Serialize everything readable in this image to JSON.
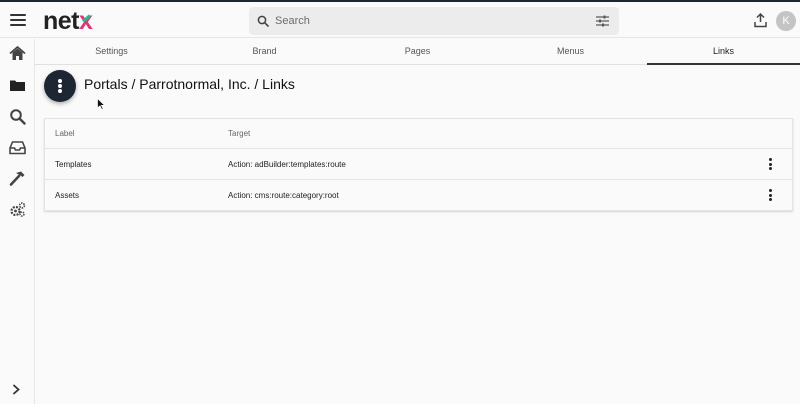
{
  "header": {
    "logo": {
      "prefix": "net",
      "x_letter": "x"
    },
    "search": {
      "placeholder": "Search",
      "value": ""
    },
    "avatar_initial": "K",
    "icons": [
      "menu-icon",
      "search-icon",
      "filter-settings-icon",
      "upload-icon"
    ]
  },
  "sidebar": {
    "items": [
      {
        "name": "home",
        "icon": "home-icon"
      },
      {
        "name": "folders",
        "icon": "folder-icon"
      },
      {
        "name": "search",
        "icon": "search-icon"
      },
      {
        "name": "inbox",
        "icon": "inbox-icon"
      },
      {
        "name": "tools",
        "icon": "hammer-icon"
      },
      {
        "name": "settings",
        "icon": "gears-icon"
      }
    ],
    "expand_icon": "chevron-right-icon"
  },
  "tabs": [
    {
      "label": "Settings",
      "active": false
    },
    {
      "label": "Brand",
      "active": false
    },
    {
      "label": "Pages",
      "active": false
    },
    {
      "label": "Menus",
      "active": false
    },
    {
      "label": "Links",
      "active": true
    }
  ],
  "main": {
    "breadcrumb": "Portals / Parrotnormal, Inc. / Links",
    "table": {
      "headers": [
        "Label",
        "Target"
      ],
      "rows": [
        {
          "label": "Templates",
          "target": "Action: adBuilder:templates:route"
        },
        {
          "label": "Assets",
          "target": "Action: cms:route:category:root"
        }
      ]
    }
  },
  "colors": {
    "logo_x_pink": "#e0357a",
    "logo_x_green": "#2ab78a",
    "fab_background": "#1f2633",
    "page_background": "#fafafa"
  }
}
